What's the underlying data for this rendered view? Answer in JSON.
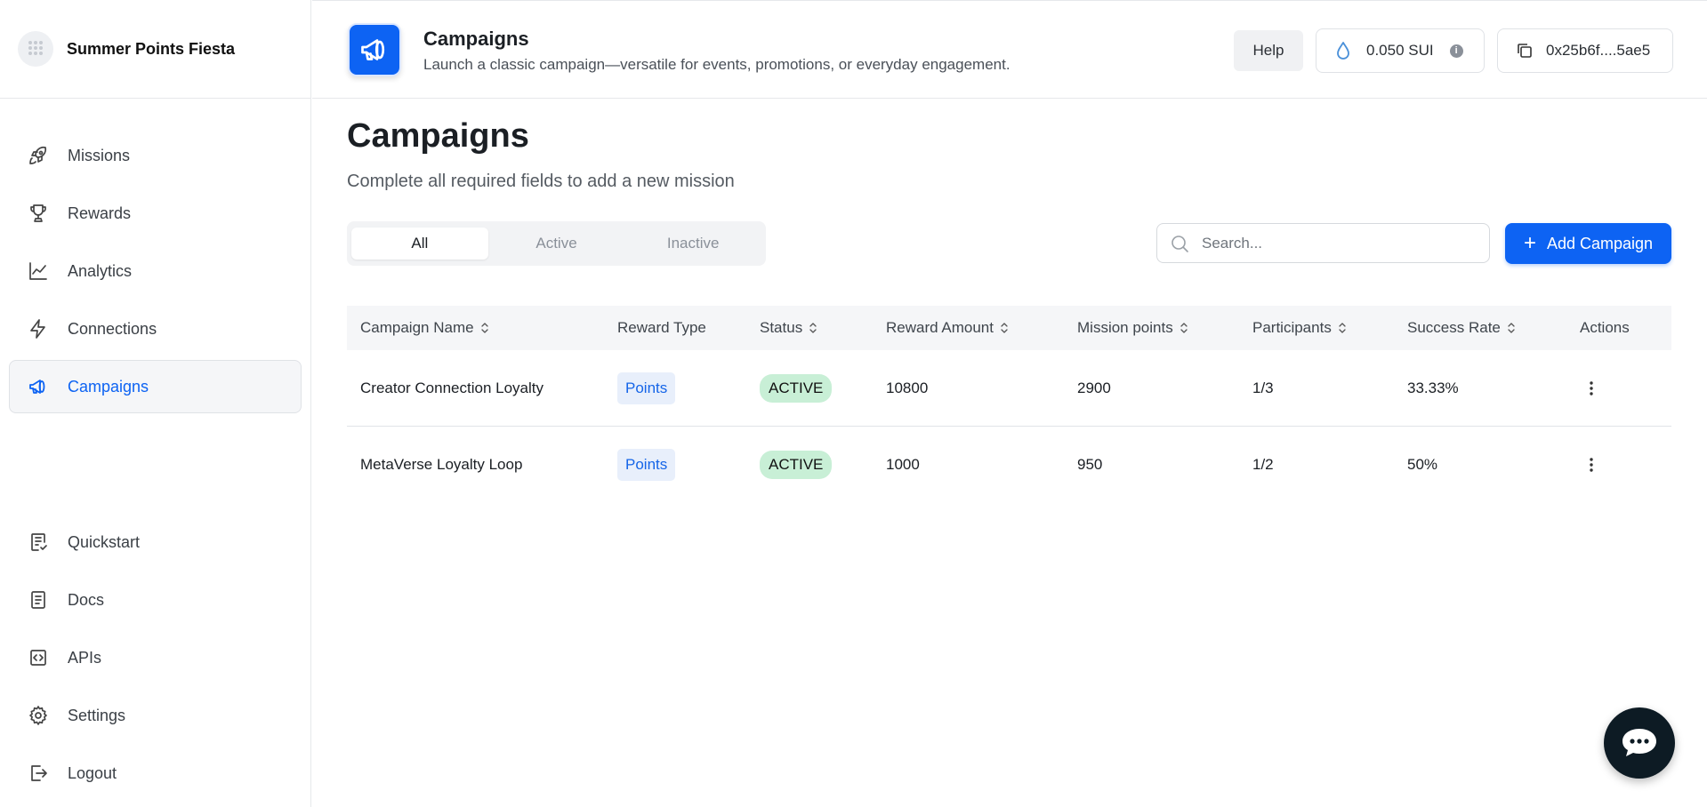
{
  "brand": {
    "name": "Summer Points Fiesta"
  },
  "sidebar": {
    "top_items": [
      {
        "label": "Missions",
        "icon": "rocket-icon"
      },
      {
        "label": "Rewards",
        "icon": "trophy-icon"
      },
      {
        "label": "Analytics",
        "icon": "chart-line-icon"
      },
      {
        "label": "Connections",
        "icon": "lightning-icon"
      },
      {
        "label": "Campaigns",
        "icon": "megaphone-icon",
        "active": true
      }
    ],
    "bottom_items": [
      {
        "label": "Quickstart",
        "icon": "checklist-icon"
      },
      {
        "label": "Docs",
        "icon": "document-icon"
      },
      {
        "label": "APIs",
        "icon": "code-icon"
      },
      {
        "label": "Settings",
        "icon": "gear-icon"
      },
      {
        "label": "Logout",
        "icon": "logout-icon"
      }
    ]
  },
  "header": {
    "title": "Campaigns",
    "subtitle": "Launch a classic campaign—versatile for events, promotions, or everyday engagement.",
    "help_label": "Help",
    "balance": "0.050 SUI",
    "address": "0x25b6f....5ae5"
  },
  "main": {
    "title": "Campaigns",
    "subtitle": "Complete all required fields to add a new mission",
    "tabs": [
      {
        "label": "All",
        "selected": true
      },
      {
        "label": "Active"
      },
      {
        "label": "Inactive"
      }
    ],
    "search": {
      "placeholder": "Search...",
      "value": ""
    },
    "add_button": "Add Campaign"
  },
  "table": {
    "columns": [
      "Campaign Name",
      "Reward Type",
      "Status",
      "Reward Amount",
      "Mission points",
      "Participants",
      "Success Rate",
      "Actions"
    ],
    "rows": [
      {
        "name": "Creator Connection Loyalty",
        "reward_type": "Points",
        "status": "ACTIVE",
        "reward_amount": "10800",
        "mission_points": "2900",
        "participants": "1/3",
        "success_rate": "33.33%"
      },
      {
        "name": "MetaVerse Loyalty Loop",
        "reward_type": "Points",
        "status": "ACTIVE",
        "reward_amount": "1000",
        "mission_points": "950",
        "participants": "1/2",
        "success_rate": "50%"
      }
    ]
  },
  "colors": {
    "accent": "#0d63f3",
    "active_badge": "#c8efd6",
    "points_badge": "#e8effb",
    "chat": "#0d1b24"
  }
}
